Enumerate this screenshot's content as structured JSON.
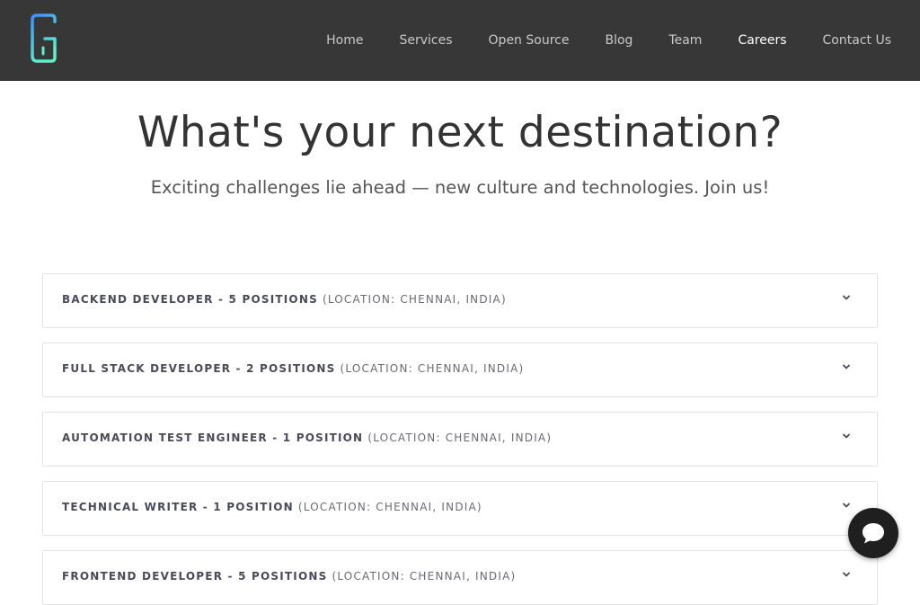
{
  "nav": {
    "items": [
      {
        "label": "Home",
        "active": false
      },
      {
        "label": "Services",
        "active": false
      },
      {
        "label": "Open Source",
        "active": false
      },
      {
        "label": "Blog",
        "active": false
      },
      {
        "label": "Team",
        "active": false
      },
      {
        "label": "Careers",
        "active": true
      },
      {
        "label": "Contact Us",
        "active": false
      }
    ]
  },
  "hero": {
    "title": "What's your next destination?",
    "subtitle": "Exciting challenges lie ahead — new culture and technologies. Join us!"
  },
  "jobs": [
    {
      "title": "Backend Developer - 5 Positions",
      "location": "(Location: Chennai, India)"
    },
    {
      "title": "Full Stack Developer - 2 Positions",
      "location": "(Location: Chennai, India)"
    },
    {
      "title": "Automation Test Engineer - 1 Position",
      "location": "(Location: Chennai, India)"
    },
    {
      "title": "Technical Writer - 1 Position",
      "location": "(Location: Chennai, India)"
    },
    {
      "title": "Frontend Developer - 5 Positions",
      "location": "(Location: Chennai, India)"
    }
  ],
  "icons": {
    "logo": "g-logo-icon",
    "expand": "chevron-down-icon",
    "chat": "chat-bubble-icon"
  },
  "colors": {
    "navbar_bg": "#373737",
    "nav_text": "#c9c9c9",
    "nav_active": "#ffffff",
    "logo_gradient_start": "#4aa8ff",
    "logo_gradient_end": "#5ef0c8",
    "heading": "#333333",
    "job_title": "#4a4a59",
    "chat_button": "#1f1f1f"
  }
}
